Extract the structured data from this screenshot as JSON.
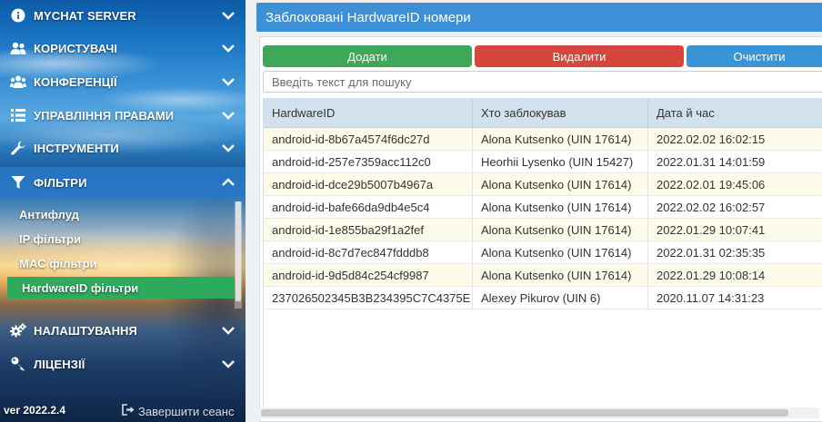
{
  "sidebar": {
    "items": [
      {
        "label": "MYCHAT SERVER",
        "icon": "info-icon",
        "chevron": "chevron-down-icon"
      },
      {
        "label": "КОРИСТУВАЧІ",
        "icon": "users-icon",
        "chevron": "chevron-down-icon"
      },
      {
        "label": "КОНФЕРЕНЦІЇ",
        "icon": "group-icon",
        "chevron": "chevron-down-icon"
      },
      {
        "label": "УПРАВЛІННЯ ПРАВАМИ",
        "icon": "list-icon",
        "chevron": "chevron-down-icon"
      },
      {
        "label": "ІНСТРУМЕНТИ",
        "icon": "wrench-icon",
        "chevron": "chevron-down-icon"
      },
      {
        "label": "ФІЛЬТРИ",
        "icon": "filter-icon",
        "chevron": "chevron-up-icon"
      },
      {
        "label": "НАЛАШТУВАННЯ",
        "icon": "gears-icon",
        "chevron": "chevron-down-icon"
      },
      {
        "label": "ЛІЦЕНЗІЇ",
        "icon": "key-icon",
        "chevron": "chevron-down-icon"
      }
    ],
    "subitems": [
      {
        "label": "Антифлуд"
      },
      {
        "label": "IP фільтри"
      },
      {
        "label": "MAC фільтри"
      },
      {
        "label": "HardwareID фільтри"
      }
    ],
    "version": "ver 2022.2.4",
    "logout": "Завершити сеанс"
  },
  "main": {
    "title": "Заблоковані HardwareID номери",
    "buttons": {
      "add": "Додати",
      "delete": "Видалити",
      "clear": "Очистити"
    },
    "search": {
      "placeholder": "Введіть текст для пошуку"
    },
    "table": {
      "columns": [
        "HardwareID",
        "Хто заблокував",
        "Дата й час"
      ],
      "rows": [
        [
          "android-id-8b67a4574f6dc27d",
          "Alona Kutsenko (UIN 17614)",
          "2022.02.02 16:02:15"
        ],
        [
          "android-id-257e7359acc112c0",
          "Heorhii Lysenko (UIN 15427)",
          "2022.01.31 14:01:59"
        ],
        [
          "android-id-dce29b5007b4967a",
          "Alona Kutsenko (UIN 17614)",
          "2022.02.01 19:45:06"
        ],
        [
          "android-id-bafe66da9db4e5c4",
          "Alona Kutsenko (UIN 17614)",
          "2022.02.02 16:02:57"
        ],
        [
          "android-id-1e855ba29f1a2fef",
          "Alona Kutsenko (UIN 17614)",
          "2022.01.29 10:07:41"
        ],
        [
          "android-id-8c7d7ec847fdddb8",
          "Alona Kutsenko (UIN 17614)",
          "2022.01.31 02:35:35"
        ],
        [
          "android-id-9d5d84c254cf9987",
          "Alona Kutsenko (UIN 17614)",
          "2022.01.29 10:08:14"
        ],
        [
          "237026502345B3B234395C7C4375E",
          "Alexey Pikurov (UIN 6)",
          "2020.11.07 14:31:23"
        ]
      ]
    }
  },
  "colors": {
    "title_bar": "#3d8fd6",
    "add": "#3ea75a",
    "delete": "#d5473d",
    "clear": "#3a94d6",
    "selected_sub": "#2eaa5c",
    "header_bg": "#d3e1ee",
    "odd_row": "#fdfbea"
  }
}
